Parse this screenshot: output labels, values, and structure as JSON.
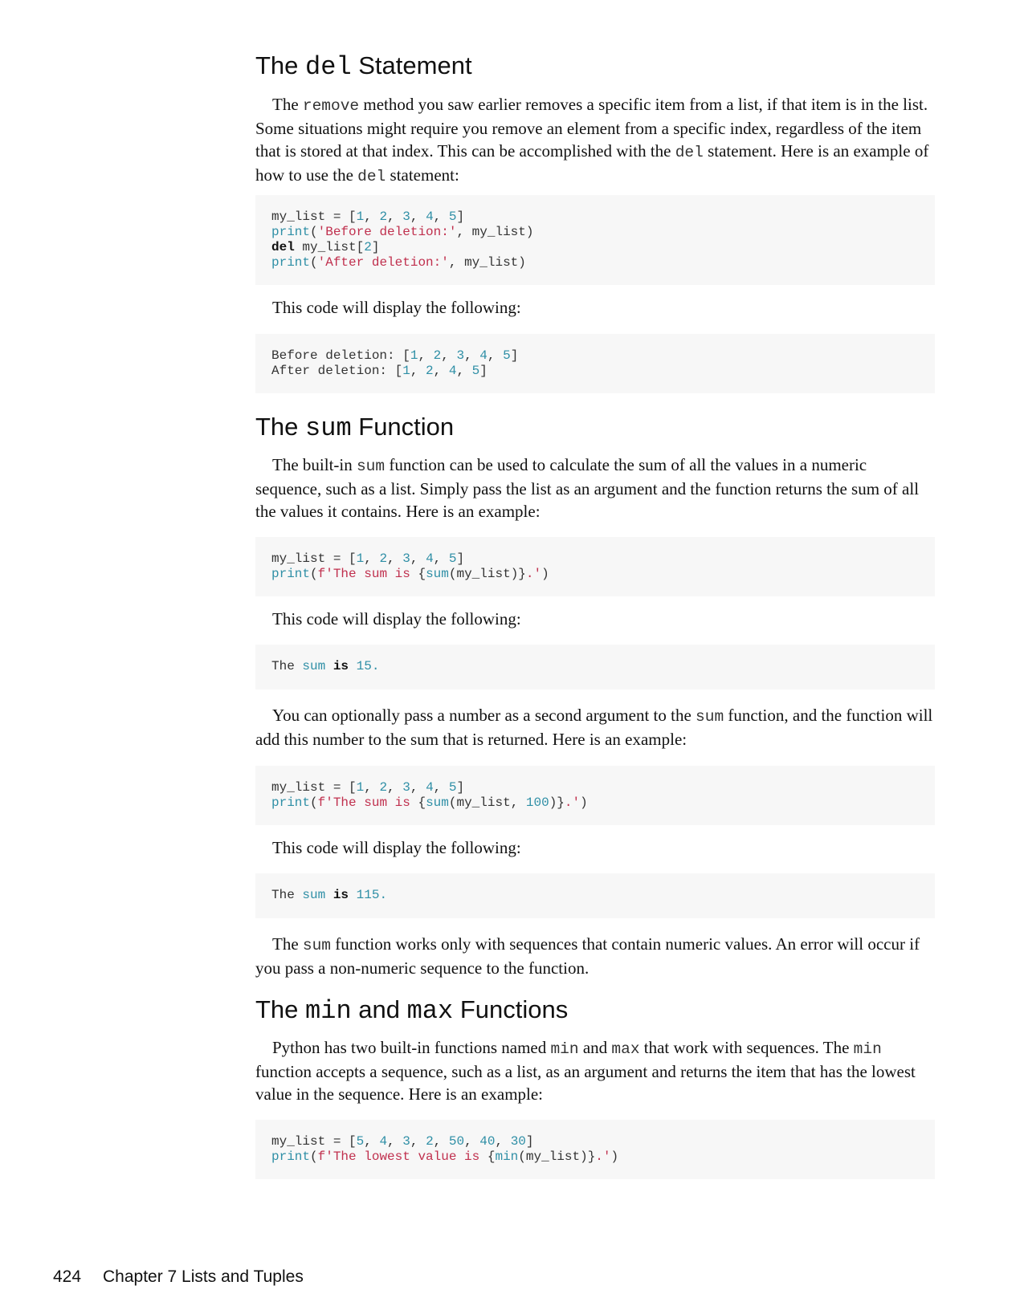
{
  "section_del": {
    "heading_pre": "The ",
    "heading_code": "del",
    "heading_post": " Statement",
    "p1": [
      {
        "t": "The "
      },
      {
        "c": "remove"
      },
      {
        "t": " method you saw earlier removes a specific item from a list, if that item is in the list. Some situations might require you remove an element from a specific index, regardless of the item that is stored at that index. This can be accomplished with the "
      },
      {
        "c": "del"
      },
      {
        "t": " statement. Here is an example of how to use the "
      },
      {
        "c": "del"
      },
      {
        "t": " statement:"
      }
    ],
    "code1": [
      [
        {
          "p": "my_list = ["
        },
        {
          "n": "1"
        },
        {
          "p": ", "
        },
        {
          "n": "2"
        },
        {
          "p": ", "
        },
        {
          "n": "3"
        },
        {
          "p": ", "
        },
        {
          "n": "4"
        },
        {
          "p": ", "
        },
        {
          "n": "5"
        },
        {
          "p": "]"
        }
      ],
      [
        {
          "k": "print"
        },
        {
          "p": "("
        },
        {
          "s": "'Before deletion:'"
        },
        {
          "p": ", my_list)"
        }
      ],
      [
        {
          "b": "del"
        },
        {
          "p": " my_list["
        },
        {
          "n": "2"
        },
        {
          "p": "]"
        }
      ],
      [
        {
          "k": "print"
        },
        {
          "p": "("
        },
        {
          "s": "'After deletion:'"
        },
        {
          "p": ", my_list)"
        }
      ]
    ],
    "p2": [
      {
        "t": "This code will display the following:"
      }
    ],
    "output1": [
      [
        {
          "p": "Before deletion: ["
        },
        {
          "n": "1"
        },
        {
          "p": ", "
        },
        {
          "n": "2"
        },
        {
          "p": ", "
        },
        {
          "n": "3"
        },
        {
          "p": ", "
        },
        {
          "n": "4"
        },
        {
          "p": ", "
        },
        {
          "n": "5"
        },
        {
          "p": "]"
        }
      ],
      [
        {
          "p": "After deletion: ["
        },
        {
          "n": "1"
        },
        {
          "p": ", "
        },
        {
          "n": "2"
        },
        {
          "p": ", "
        },
        {
          "n": "4"
        },
        {
          "p": ", "
        },
        {
          "n": "5"
        },
        {
          "p": "]"
        }
      ]
    ]
  },
  "section_sum": {
    "heading_pre": "The ",
    "heading_code": "sum",
    "heading_post": " Function",
    "p1": [
      {
        "t": "The built-in "
      },
      {
        "c": "sum"
      },
      {
        "t": " function can be used to calculate the sum of all the values in a numeric sequence, such as a list. Simply pass the list as an argument and the function returns the sum of all the values it contains. Here is an example:"
      }
    ],
    "code1": [
      [
        {
          "p": "my_list = ["
        },
        {
          "n": "1"
        },
        {
          "p": ", "
        },
        {
          "n": "2"
        },
        {
          "p": ", "
        },
        {
          "n": "3"
        },
        {
          "p": ", "
        },
        {
          "n": "4"
        },
        {
          "p": ", "
        },
        {
          "n": "5"
        },
        {
          "p": "]"
        }
      ],
      [
        {
          "k": "print"
        },
        {
          "p": "("
        },
        {
          "s": "f'The sum is "
        },
        {
          "p": "{"
        },
        {
          "k": "sum"
        },
        {
          "p": "(my_list)}"
        },
        {
          "s": ".'"
        },
        {
          "p": ")"
        }
      ]
    ],
    "p2": [
      {
        "t": "This code will display the following:"
      }
    ],
    "output1": [
      [
        {
          "p": "The "
        },
        {
          "k": "sum"
        },
        {
          "p": " "
        },
        {
          "b": "is"
        },
        {
          "p": " "
        },
        {
          "n": "15."
        }
      ]
    ],
    "p3": [
      {
        "t": "You can optionally pass a number as a second argument to the "
      },
      {
        "c": "sum"
      },
      {
        "t": " function, and the function will add this number to the sum that is returned. Here is an example:"
      }
    ],
    "code2": [
      [
        {
          "p": "my_list = ["
        },
        {
          "n": "1"
        },
        {
          "p": ", "
        },
        {
          "n": "2"
        },
        {
          "p": ", "
        },
        {
          "n": "3"
        },
        {
          "p": ", "
        },
        {
          "n": "4"
        },
        {
          "p": ", "
        },
        {
          "n": "5"
        },
        {
          "p": "]"
        }
      ],
      [
        {
          "k": "print"
        },
        {
          "p": "("
        },
        {
          "s": "f'The sum is "
        },
        {
          "p": "{"
        },
        {
          "k": "sum"
        },
        {
          "p": "(my_list, "
        },
        {
          "n": "100"
        },
        {
          "p": ")}"
        },
        {
          "s": ".'"
        },
        {
          "p": ")"
        }
      ]
    ],
    "p4": [
      {
        "t": "This code will display the following:"
      }
    ],
    "output2": [
      [
        {
          "p": "The "
        },
        {
          "k": "sum"
        },
        {
          "p": " "
        },
        {
          "b": "is"
        },
        {
          "p": " "
        },
        {
          "n": "115."
        }
      ]
    ],
    "p5": [
      {
        "t": "The "
      },
      {
        "c": "sum"
      },
      {
        "t": " function works only with sequences that contain numeric values. An error will occur if you pass a non-numeric sequence to the function."
      }
    ]
  },
  "section_minmax": {
    "heading_pre": "The ",
    "heading_code1": "min",
    "heading_mid": " and ",
    "heading_code2": "max",
    "heading_post": " Functions",
    "p1": [
      {
        "t": "Python has two built-in functions named "
      },
      {
        "c": "min"
      },
      {
        "t": " and "
      },
      {
        "c": "max"
      },
      {
        "t": " that work with sequences. The "
      },
      {
        "c": "min"
      },
      {
        "t": " function accepts a sequence, such as a list, as an argument and returns the item that has the lowest value in the sequence. Here is an example:"
      }
    ],
    "code1": [
      [
        {
          "p": "my_list = ["
        },
        {
          "n": "5"
        },
        {
          "p": ", "
        },
        {
          "n": "4"
        },
        {
          "p": ", "
        },
        {
          "n": "3"
        },
        {
          "p": ", "
        },
        {
          "n": "2"
        },
        {
          "p": ", "
        },
        {
          "n": "50"
        },
        {
          "p": ", "
        },
        {
          "n": "40"
        },
        {
          "p": ", "
        },
        {
          "n": "30"
        },
        {
          "p": "]"
        }
      ],
      [
        {
          "k": "print"
        },
        {
          "p": "("
        },
        {
          "s": "f'The lowest value is "
        },
        {
          "p": "{"
        },
        {
          "k": "min"
        },
        {
          "p": "(my_list)}"
        },
        {
          "s": ".'"
        },
        {
          "p": ")"
        }
      ]
    ]
  },
  "footer": {
    "page_number": "424",
    "chapter": "Chapter 7 Lists and Tuples"
  }
}
